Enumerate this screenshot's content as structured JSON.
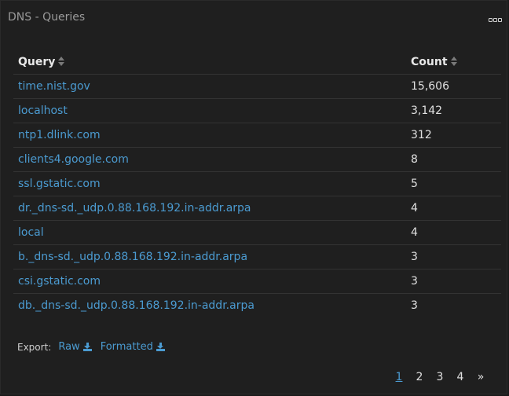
{
  "panel": {
    "title": "DNS - Queries",
    "menu_icon": "ellipsis-icon"
  },
  "table": {
    "columns": [
      {
        "label": "Query",
        "sort_icon": "sort-icon"
      },
      {
        "label": "Count",
        "sort_icon": "sort-icon"
      }
    ],
    "rows": [
      {
        "query": "time.nist.gov",
        "count": "15,606"
      },
      {
        "query": "localhost",
        "count": "3,142"
      },
      {
        "query": "ntp1.dlink.com",
        "count": "312"
      },
      {
        "query": "clients4.google.com",
        "count": "8"
      },
      {
        "query": "ssl.gstatic.com",
        "count": "5"
      },
      {
        "query": "dr._dns-sd._udp.0.88.168.192.in-addr.arpa",
        "count": "4"
      },
      {
        "query": "local",
        "count": "4"
      },
      {
        "query": "b._dns-sd._udp.0.88.168.192.in-addr.arpa",
        "count": "3"
      },
      {
        "query": "csi.gstatic.com",
        "count": "3"
      },
      {
        "query": "db._dns-sd._udp.0.88.168.192.in-addr.arpa",
        "count": "3"
      }
    ]
  },
  "export": {
    "label": "Export:",
    "raw_label": "Raw",
    "formatted_label": "Formatted",
    "icon": "download-icon"
  },
  "pagination": {
    "pages": [
      "1",
      "2",
      "3",
      "4"
    ],
    "active_page": "1",
    "next_label": "»"
  },
  "colors": {
    "background": "#1f1f1f",
    "link": "#4b9bd1",
    "text": "#e0e0e0",
    "title": "#9a9a9a"
  }
}
